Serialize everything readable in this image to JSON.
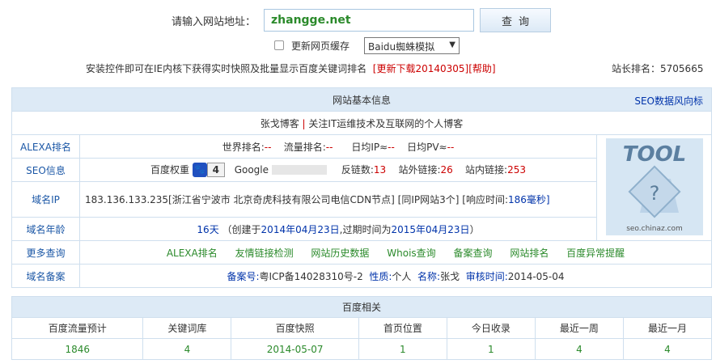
{
  "search": {
    "label": "请输入网站地址：",
    "value": "zhangge.net",
    "button": "查询"
  },
  "options": {
    "cache_label": "更新网页缓存",
    "spider_selected": "Baidu蜘蛛模拟"
  },
  "notice": {
    "text": "安装控件即可在IE内核下获得实时快照及批量显示百度关键词排名",
    "download": "[更新下载20140305]",
    "help": "[帮助]",
    "rank_label": "站长排名：",
    "rank_value": "5705665"
  },
  "basic": {
    "header": "网站基本信息",
    "seo_link": "SEO数据风向标",
    "site_title": "张戈博客",
    "site_sep": "|",
    "site_desc": "关注IT运维技术及互联网的个人博客",
    "alexa_label": "ALEXA排名",
    "world_rank_label": "世界排名:",
    "world_rank_value": "--",
    "flow_rank_label": "流量排名:",
    "flow_rank_value": "--",
    "daily_ip_label": "日均IP≈",
    "daily_ip_value": "--",
    "daily_pv_label": "日均PV≈",
    "daily_pv_value": "--",
    "seo_label": "SEO信息",
    "baidu_weight_label": "百度权重",
    "baidu_weight_value": "4",
    "google_label": "Google",
    "backlinks_label": "反链数:",
    "backlinks_value": "13",
    "outlinks_label": "站外链接:",
    "outlinks_value": "26",
    "inlinks_label": "站内链接:",
    "inlinks_value": "253",
    "ip_label": "域名IP",
    "ip_value": "183.136.133.235[浙江省宁波市 北京奇虎科技有限公司电信CDN节点]",
    "same_ip": "[同IP网站3个]",
    "response_label": "[响应时间:",
    "response_value": "186毫秒]",
    "age_label": "域名年龄",
    "age_value": "16天",
    "age_created_label": "（创建于",
    "age_created": "2014年04月23日",
    "age_expire_label": ",过期时间为",
    "age_expire": "2015年04月23日",
    "age_end": "）",
    "more_label": "更多查询",
    "more_links": [
      "ALEXA排名",
      "友情链接检测",
      "网站历史数据",
      "Whois查询",
      "备案查询",
      "网站排名",
      "百度异常提醒"
    ],
    "icp_label": "域名备案",
    "icp_no_label": "备案号:",
    "icp_no": "粤ICP备14028310号-2",
    "nature_label": "性质:",
    "nature": "个人",
    "name_label": "名称:",
    "name": "张戈",
    "audit_label": "审核时间:",
    "audit": "2014-05-04",
    "logo_text": "TOOL",
    "logo_caption": "seo.chinaz.com"
  },
  "baidu": {
    "header": "百度相关",
    "columns": [
      "百度流量预计",
      "关键词库",
      "百度快照",
      "首页位置",
      "今日收录",
      "最近一周",
      "最近一月"
    ],
    "values": [
      "1846",
      "4",
      "2014-05-07",
      "1",
      "1",
      "4",
      "4"
    ]
  },
  "colors": {
    "accent_blue": "#0033aa",
    "green": "#2b8a2b",
    "red": "#cc0000",
    "header_bg": "#ddeaf6"
  }
}
